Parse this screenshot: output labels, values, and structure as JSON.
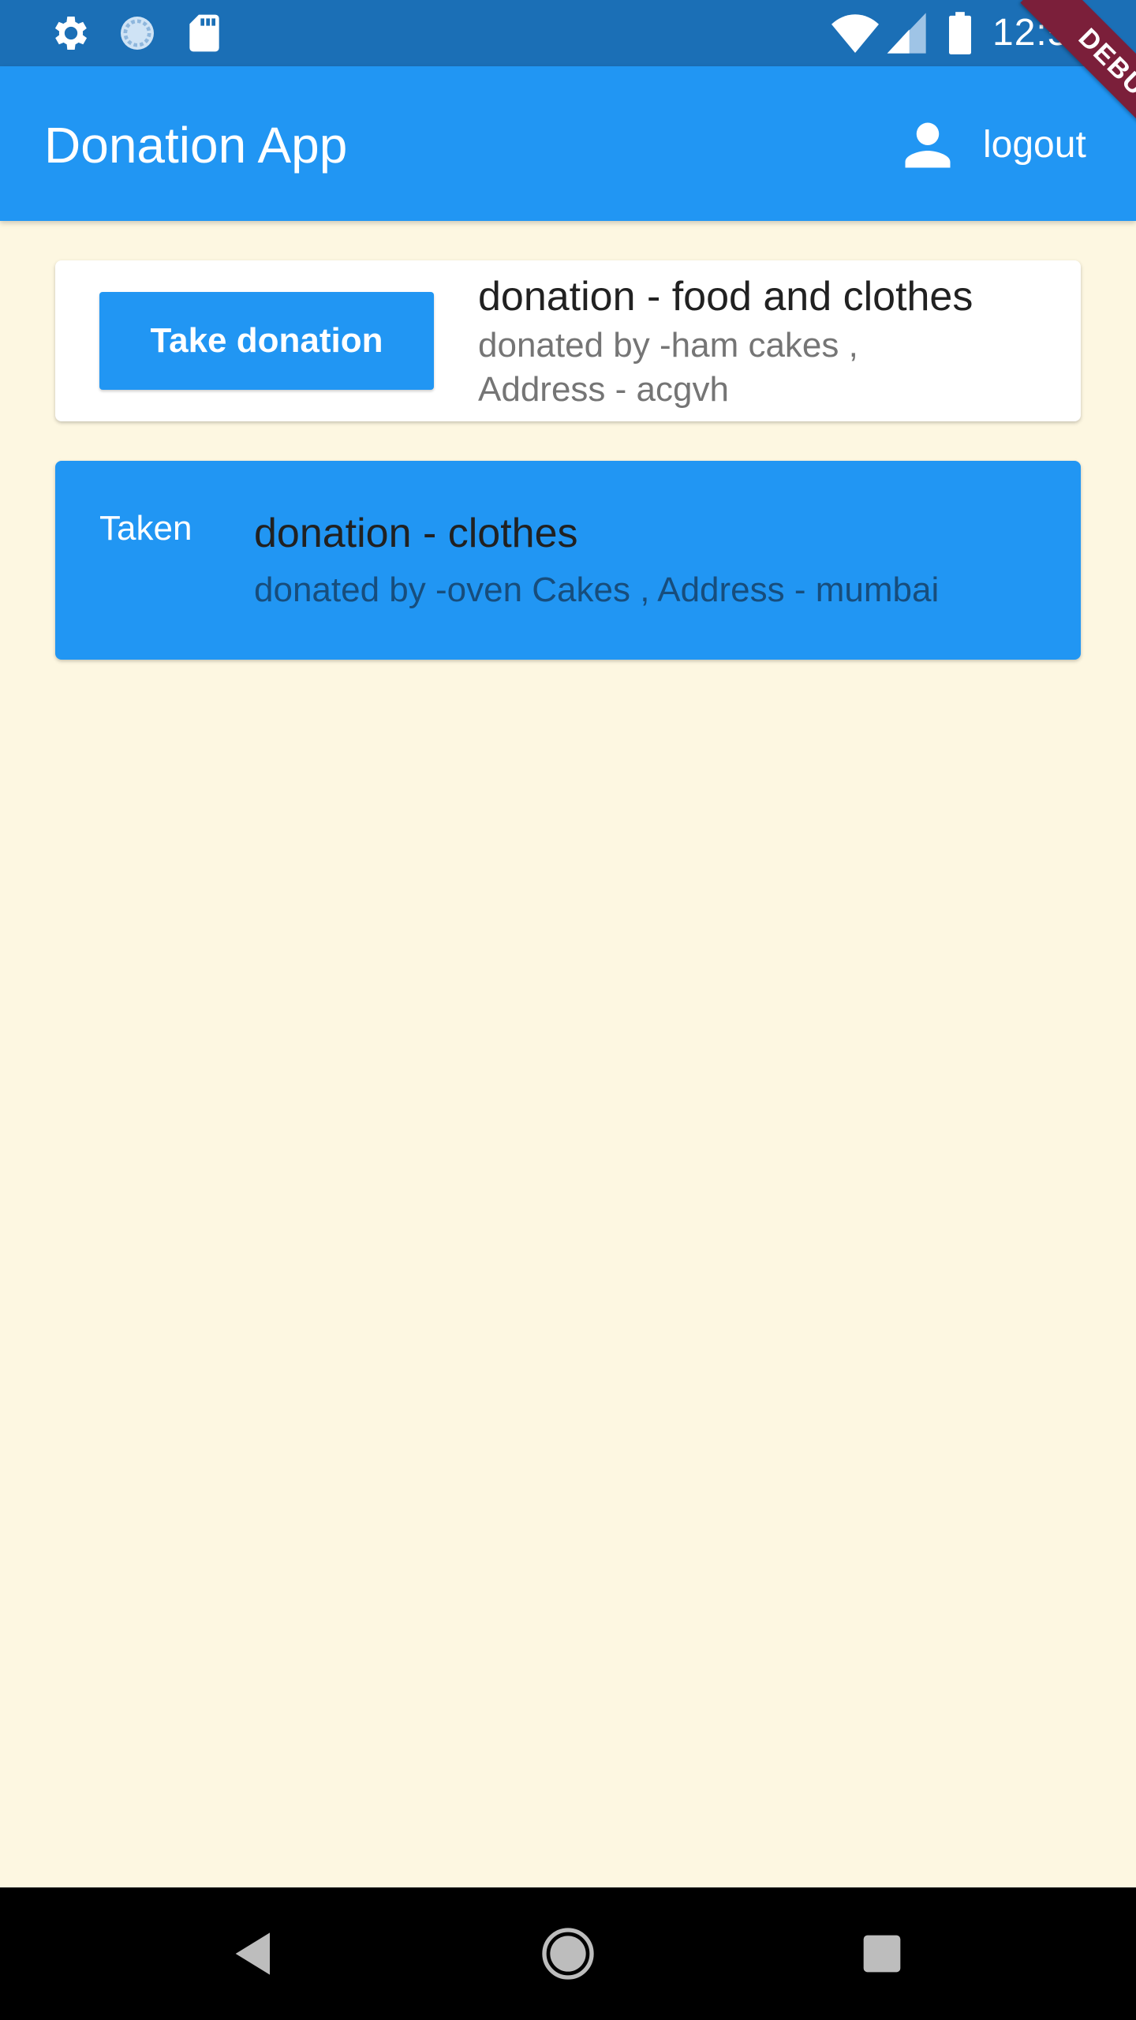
{
  "status_bar": {
    "time": "12:56",
    "left_icons": [
      "gear-icon",
      "sync-icon",
      "sd-card-icon"
    ],
    "right_icons": [
      "wifi-icon",
      "signal-icon",
      "battery-icon"
    ]
  },
  "debug_banner": "DEBUG",
  "app_bar": {
    "title": "Donation App",
    "logout_label": "logout",
    "logout_icon": "person-icon"
  },
  "donations": [
    {
      "status": "available",
      "action_label": "Take donation",
      "title": "donation - food and clothes",
      "subtitle": "donated by -ham cakes , Address - acgvh"
    },
    {
      "status": "taken",
      "status_label": "Taken",
      "title": "donation - clothes",
      "subtitle": "donated by -oven Cakes , Address - mumbai"
    }
  ],
  "nav_bar": {
    "buttons": [
      "back-icon",
      "home-icon",
      "recents-icon"
    ]
  },
  "colors": {
    "primary": "#2196f3",
    "status_bar": "#1b6fb6",
    "background": "#fdf7e1",
    "debug_ribbon": "#7b1f3a"
  }
}
